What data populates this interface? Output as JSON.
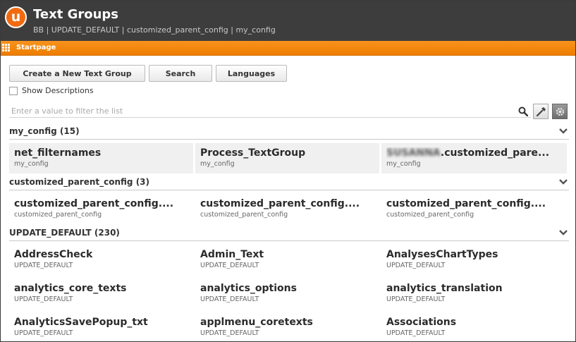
{
  "header": {
    "logo_letter": "u",
    "title": "Text Groups",
    "breadcrumb": "BB | UPDATE_DEFAULT | customized_parent_config | my_config"
  },
  "tabbar": {
    "tab_label": "Startpage"
  },
  "toolbar": {
    "create_label": "Create a New Text Group",
    "search_label": "Search",
    "languages_label": "Languages"
  },
  "show_descriptions_label": "Show Descriptions",
  "filter": {
    "placeholder": "Enter a value to filter the list"
  },
  "sections": [
    {
      "title": "my_config (15)",
      "items": [
        {
          "name": "net_filternames",
          "sub": "my_config"
        },
        {
          "name": "Process_TextGroup",
          "sub": "my_config"
        },
        {
          "name_redacted": "SUSANNA",
          "name_suffix": ".customized_pare...",
          "sub": "my_config"
        }
      ]
    },
    {
      "title": "customized_parent_config (3)",
      "items": [
        {
          "name": "customized_parent_config....",
          "sub": "customized_parent_config"
        },
        {
          "name": "customized_parent_config....",
          "sub": "customized_parent_config"
        },
        {
          "name": "customized_parent_config....",
          "sub": "customized_parent_config"
        }
      ]
    },
    {
      "title": "UPDATE_DEFAULT (230)",
      "items": [
        {
          "name": "AddressCheck",
          "sub": "UPDATE_DEFAULT"
        },
        {
          "name": "Admin_Text",
          "sub": "UPDATE_DEFAULT"
        },
        {
          "name": "AnalysesChartTypes",
          "sub": "UPDATE_DEFAULT"
        },
        {
          "name": "analytics_core_texts",
          "sub": "UPDATE_DEFAULT"
        },
        {
          "name": "analytics_options",
          "sub": "UPDATE_DEFAULT"
        },
        {
          "name": "analytics_translation",
          "sub": "UPDATE_DEFAULT"
        },
        {
          "name": "AnalyticsSavePopup_txt",
          "sub": "UPDATE_DEFAULT"
        },
        {
          "name": "applmenu_coretexts",
          "sub": "UPDATE_DEFAULT"
        },
        {
          "name": "Associations",
          "sub": "UPDATE_DEFAULT"
        }
      ]
    }
  ],
  "colors": {
    "header_bg": "#3d3d3d",
    "brand_orange": "#f26a10",
    "tabbar_orange": "#f7931e",
    "card_shade": "#f0f0f0"
  }
}
